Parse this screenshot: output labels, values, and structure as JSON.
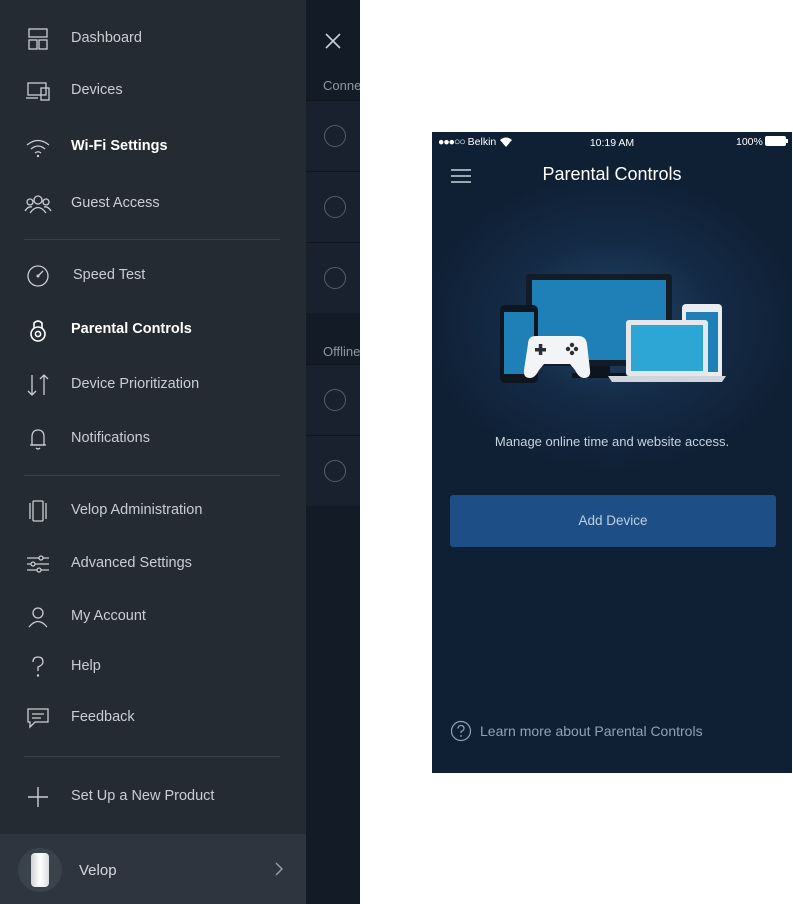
{
  "menu": {
    "items": [
      {
        "label": "Dashboard",
        "icon": "dashboard-icon"
      },
      {
        "label": "Devices",
        "icon": "devices-icon"
      },
      {
        "label": "Wi-Fi Settings",
        "icon": "wifi-icon"
      },
      {
        "label": "Guest Access",
        "icon": "guest-access-icon"
      },
      {
        "label": "Speed Test",
        "icon": "speed-test-icon"
      },
      {
        "label": "Parental Controls",
        "icon": "parental-controls-icon",
        "active": true
      },
      {
        "label": "Device Prioritization",
        "icon": "prioritization-icon"
      },
      {
        "label": "Notifications",
        "icon": "bell-icon"
      },
      {
        "label": "Velop Administration",
        "icon": "velop-admin-icon"
      },
      {
        "label": "Advanced Settings",
        "icon": "sliders-icon"
      },
      {
        "label": "My Account",
        "icon": "account-icon"
      },
      {
        "label": "Help",
        "icon": "question-icon"
      },
      {
        "label": "Feedback",
        "icon": "feedback-icon"
      },
      {
        "label": "Set Up a New Product",
        "icon": "plus-icon"
      }
    ],
    "footer": {
      "label": "Velop"
    }
  },
  "behind": {
    "connected_heading": "Conne",
    "offline_heading": "Offline"
  },
  "phone": {
    "status": {
      "carrier": "Belkin",
      "carrier_dots": "●●●○○",
      "time": "10:19 AM",
      "battery": "100%"
    },
    "title": "Parental Controls",
    "description": "Manage online time and website access.",
    "add_device_label": "Add Device",
    "learn_more": "Learn more about Parental Controls"
  },
  "colors": {
    "menu_bg": "#252b33",
    "phone_bg": "#142a45",
    "button_bg": "#1d4f86"
  }
}
